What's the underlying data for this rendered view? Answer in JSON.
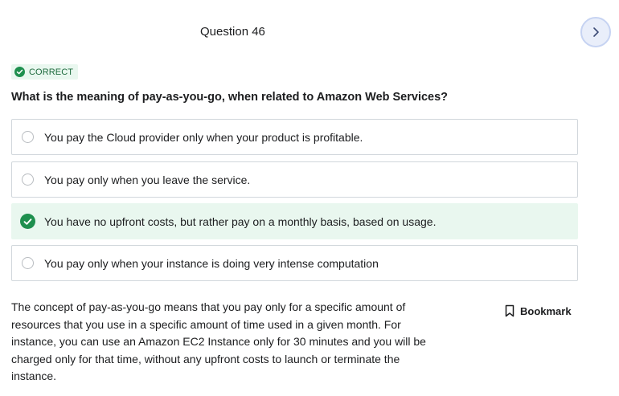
{
  "question": {
    "title": "Question 46",
    "status": "CORRECT",
    "text": "What is the meaning of pay-as-you-go, when related to Amazon Web Services?"
  },
  "options": [
    {
      "label": "You pay the Cloud provider only when your product is profitable.",
      "selected": false,
      "correct": false
    },
    {
      "label": "You pay only when you leave the service.",
      "selected": false,
      "correct": false
    },
    {
      "label": "You have no upfront costs, but rather pay on a monthly basis, based on usage.",
      "selected": true,
      "correct": true
    },
    {
      "label": "You pay only when your instance is doing very intense computation",
      "selected": false,
      "correct": false
    }
  ],
  "explanation": "The concept of pay-as-you-go means that you pay only for a specific amount of resources that you use in a specific amount of time used in a given month. For instance, you can use an Amazon EC2 Instance only for 30 minutes and you will be charged only for that time, without any upfront costs to launch or terminate the instance.",
  "bookmark": {
    "label": "Bookmark"
  },
  "icons": {
    "next": "chevron-right-icon",
    "status": "check-circle-icon",
    "bookmark": "bookmark-icon"
  },
  "colors": {
    "correct_green": "#1e8f4e",
    "correct_bg": "#e9f7ef",
    "next_button_bg": "#e9eefa"
  }
}
